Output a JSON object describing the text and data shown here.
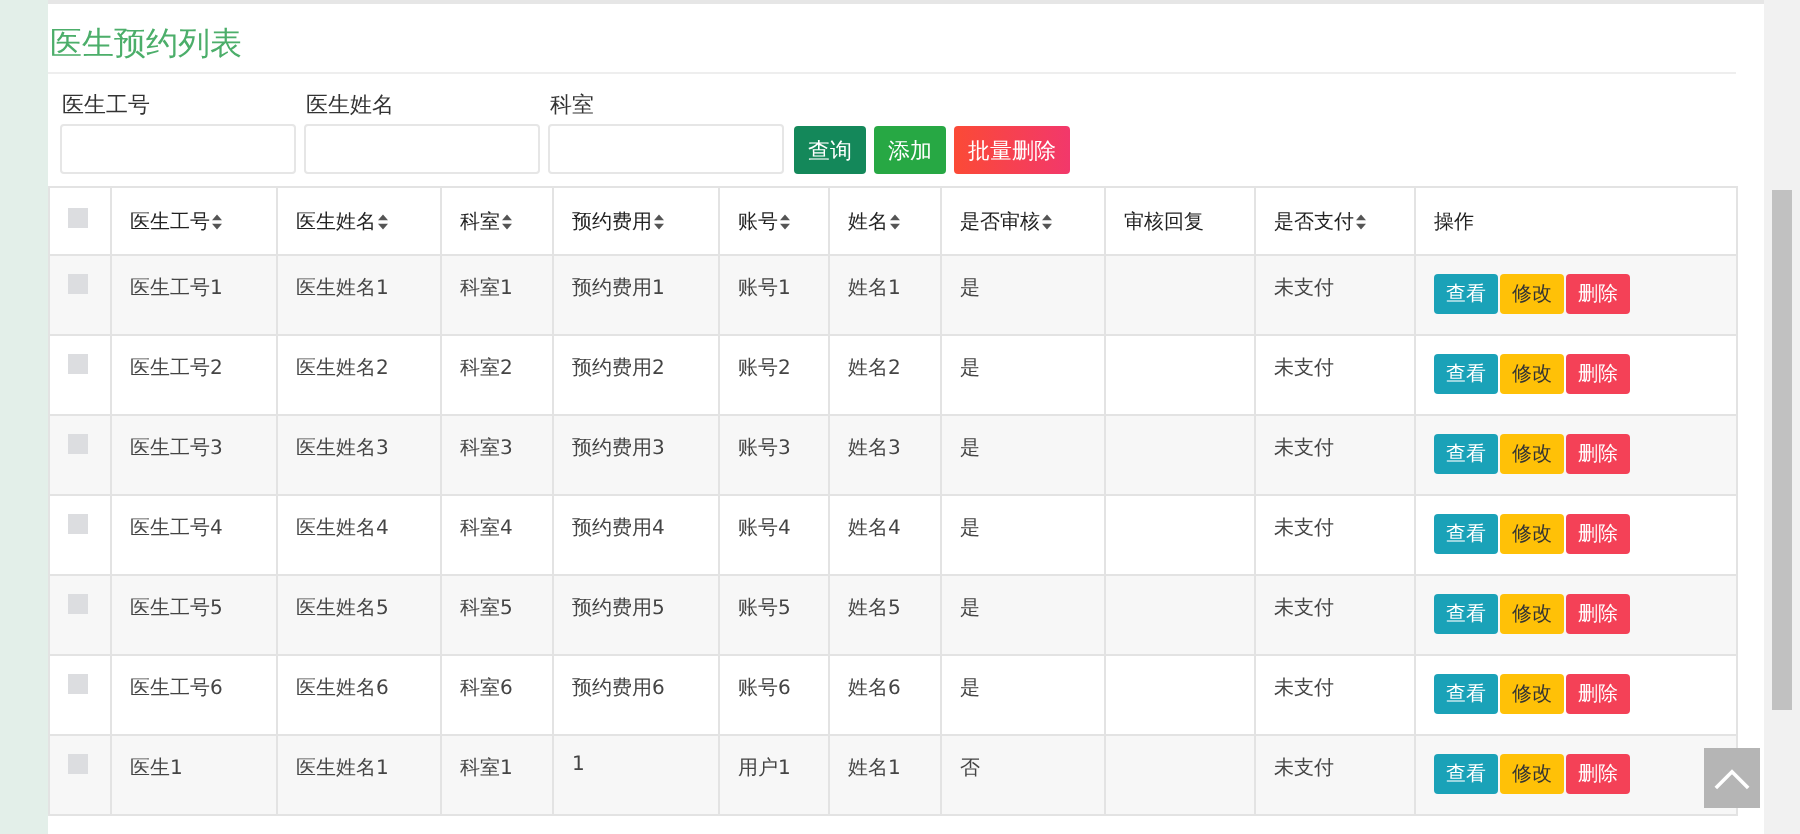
{
  "title": "医生预约列表",
  "search": {
    "fields": [
      {
        "label": "医生工号"
      },
      {
        "label": "医生姓名"
      },
      {
        "label": "科室"
      }
    ],
    "buttons": [
      {
        "label": "查询",
        "kind": "query"
      },
      {
        "label": "添加",
        "kind": "add"
      },
      {
        "label": "批量删除",
        "kind": "delete"
      }
    ]
  },
  "table": {
    "select_all_checked": false,
    "columns": [
      {
        "label": "医生工号",
        "sortable": true
      },
      {
        "label": "医生姓名",
        "sortable": true
      },
      {
        "label": "科室",
        "sortable": true
      },
      {
        "label": "预约费用",
        "sortable": true
      },
      {
        "label": "账号",
        "sortable": true
      },
      {
        "label": "姓名",
        "sortable": true
      },
      {
        "label": "是否审核",
        "sortable": true
      },
      {
        "label": "审核回复",
        "sortable": false
      },
      {
        "label": "是否支付",
        "sortable": true
      },
      {
        "label": "操作",
        "sortable": false
      }
    ],
    "rows": [
      {
        "checked": false,
        "cells": [
          "医生工号1",
          "医生姓名1",
          "科室1",
          "预约费用1",
          "账号1",
          "姓名1",
          "是",
          "",
          "未支付"
        ],
        "actions": [
          {
            "label": "查看",
            "kind": "view"
          },
          {
            "label": "修改",
            "kind": "edit"
          },
          {
            "label": "删除",
            "kind": "delete"
          }
        ]
      },
      {
        "checked": false,
        "cells": [
          "医生工号2",
          "医生姓名2",
          "科室2",
          "预约费用2",
          "账号2",
          "姓名2",
          "是",
          "",
          "未支付"
        ],
        "actions": [
          {
            "label": "查看",
            "kind": "view"
          },
          {
            "label": "修改",
            "kind": "edit"
          },
          {
            "label": "删除",
            "kind": "delete"
          }
        ]
      },
      {
        "checked": false,
        "cells": [
          "医生工号3",
          "医生姓名3",
          "科室3",
          "预约费用3",
          "账号3",
          "姓名3",
          "是",
          "",
          "未支付"
        ],
        "actions": [
          {
            "label": "查看",
            "kind": "view"
          },
          {
            "label": "修改",
            "kind": "edit"
          },
          {
            "label": "删除",
            "kind": "delete"
          }
        ]
      },
      {
        "checked": false,
        "cells": [
          "医生工号4",
          "医生姓名4",
          "科室4",
          "预约费用4",
          "账号4",
          "姓名4",
          "是",
          "",
          "未支付"
        ],
        "actions": [
          {
            "label": "查看",
            "kind": "view"
          },
          {
            "label": "修改",
            "kind": "edit"
          },
          {
            "label": "删除",
            "kind": "delete"
          }
        ]
      },
      {
        "checked": false,
        "cells": [
          "医生工号5",
          "医生姓名5",
          "科室5",
          "预约费用5",
          "账号5",
          "姓名5",
          "是",
          "",
          "未支付"
        ],
        "actions": [
          {
            "label": "查看",
            "kind": "view"
          },
          {
            "label": "修改",
            "kind": "edit"
          },
          {
            "label": "删除",
            "kind": "delete"
          }
        ]
      },
      {
        "checked": false,
        "cells": [
          "医生工号6",
          "医生姓名6",
          "科室6",
          "预约费用6",
          "账号6",
          "姓名6",
          "是",
          "",
          "未支付"
        ],
        "actions": [
          {
            "label": "查看",
            "kind": "view"
          },
          {
            "label": "修改",
            "kind": "edit"
          },
          {
            "label": "删除",
            "kind": "delete"
          }
        ]
      },
      {
        "checked": false,
        "cells": [
          "医生1",
          "医生姓名1",
          "科室1",
          "1",
          "用户1",
          "姓名1",
          "否",
          "",
          "未支付"
        ],
        "actions": [
          {
            "label": "查看",
            "kind": "view"
          },
          {
            "label": "修改",
            "kind": "edit"
          },
          {
            "label": "删除",
            "kind": "delete"
          }
        ]
      }
    ]
  }
}
